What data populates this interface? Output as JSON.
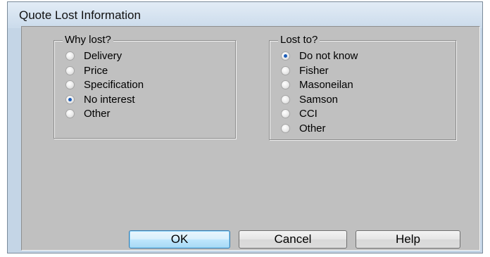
{
  "window": {
    "title": "Quote Lost Information"
  },
  "why_lost": {
    "legend": "Why lost?",
    "options": [
      {
        "label": "Delivery",
        "checked": false
      },
      {
        "label": "Price",
        "checked": false
      },
      {
        "label": "Specification",
        "checked": false
      },
      {
        "label": "No interest",
        "checked": true
      },
      {
        "label": "Other",
        "checked": false
      }
    ]
  },
  "lost_to": {
    "legend": "Lost to?",
    "options": [
      {
        "label": "Do not know",
        "checked": true
      },
      {
        "label": "Fisher",
        "checked": false
      },
      {
        "label": "Masoneilan",
        "checked": false
      },
      {
        "label": "Samson",
        "checked": false
      },
      {
        "label": "CCI",
        "checked": false
      },
      {
        "label": "Other",
        "checked": false
      }
    ]
  },
  "buttons": {
    "ok": "OK",
    "cancel": "Cancel",
    "help": "Help"
  },
  "colors": {
    "accent": "#1b5cb8",
    "dialog_bg": "#c0c0c0",
    "title_bar": "#d7e4f1"
  }
}
